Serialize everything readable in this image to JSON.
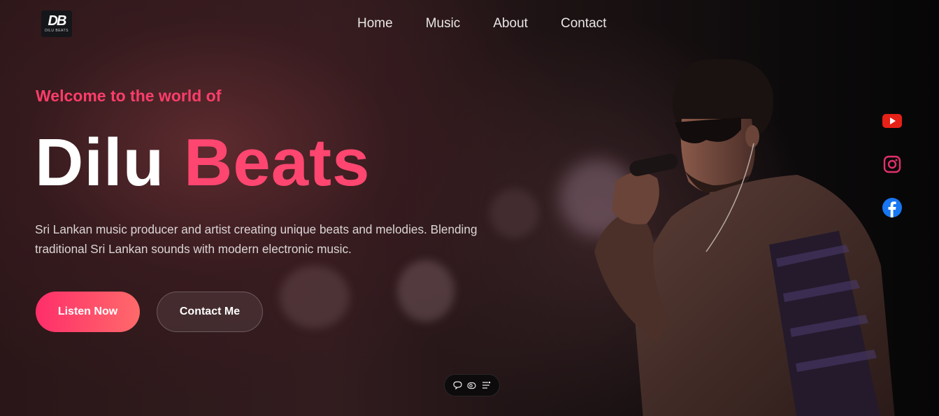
{
  "brand": {
    "logo_mark": "DB",
    "logo_text": "DILU BEATS"
  },
  "nav": {
    "items": [
      {
        "label": "Home"
      },
      {
        "label": "Music"
      },
      {
        "label": "About"
      },
      {
        "label": "Contact"
      }
    ]
  },
  "hero": {
    "welcome": "Welcome to the world of",
    "title_first": "Dilu",
    "title_second": "Beats",
    "description": "Sri Lankan music producer and artist creating unique beats and melodies. Blending traditional Sri Lankan sounds with modern electronic music.",
    "primary_button": "Listen Now",
    "secondary_button": "Contact Me"
  },
  "social": [
    {
      "icon": "youtube-icon",
      "color": "#e62117"
    },
    {
      "icon": "instagram-icon",
      "color": "#e1306c"
    },
    {
      "icon": "facebook-icon",
      "color": "#1877f2"
    }
  ],
  "toolbar": {
    "icons": [
      "comment-icon",
      "eye-icon",
      "settings-list-icon"
    ]
  },
  "colors": {
    "accent": "#ff4670",
    "welcome": "#ff3d6a",
    "button_gradient_start": "#ff2e6a",
    "button_gradient_end": "#ff6a6a"
  }
}
